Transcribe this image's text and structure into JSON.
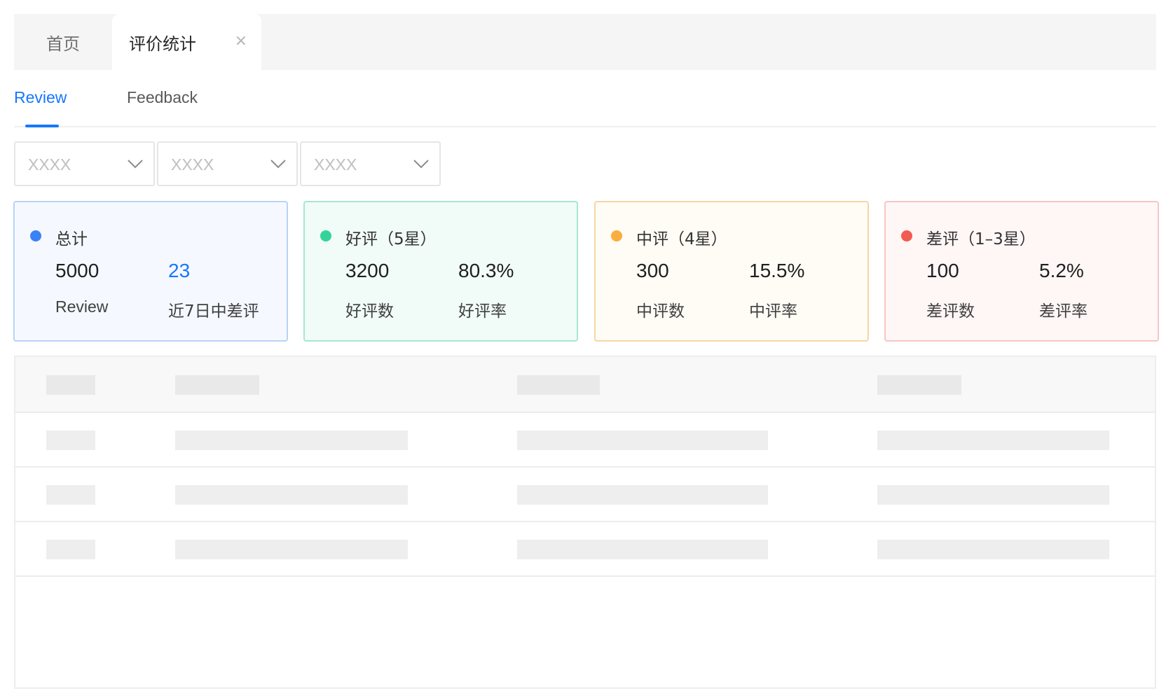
{
  "page_tabs": [
    {
      "label": "首页",
      "active": false
    },
    {
      "label": "评价统计",
      "active": true,
      "closable": true
    }
  ],
  "sub_tabs": [
    {
      "label": "Review",
      "active": true
    },
    {
      "label": "Feedback",
      "active": false
    }
  ],
  "filters": [
    {
      "value": "XXXX",
      "icon": "chevron-down-icon"
    },
    {
      "value": "XXXX",
      "icon": "chevron-down-icon"
    },
    {
      "value": "XXXX",
      "icon": "chevron-down-icon"
    }
  ],
  "cards": [
    {
      "title": "总计",
      "value1": "5000",
      "label1": "Review",
      "value2": "23",
      "label2": "近7日中差评",
      "dot_color": "#3b82f6",
      "bg": "#f5f9ff",
      "border": "#b9d3f5"
    },
    {
      "title": "好评（5星）",
      "value1": "3200",
      "label1": "好评数",
      "value2": "80.3%",
      "label2": "好评率",
      "dot_color": "#34d399",
      "bg": "#f1fbf8",
      "border": "#a8e6cf"
    },
    {
      "title": "中评（4星）",
      "value1": "300",
      "label1": "中评数",
      "value2": "15.5%",
      "label2": "中评率",
      "dot_color": "#fbad3f",
      "bg": "#fffbf5",
      "border": "#f7d6a3"
    },
    {
      "title": "差评（1–3星）",
      "value1": "100",
      "label1": "差评数",
      "value2": "5.2%",
      "label2": "差评率",
      "dot_color": "#f25b50",
      "bg": "#fff6f6",
      "border": "#f7c6c4"
    }
  ],
  "colors": {
    "accent": "#1677ff"
  },
  "table": {
    "state": "loading-skeleton",
    "visible_rows": 3
  }
}
